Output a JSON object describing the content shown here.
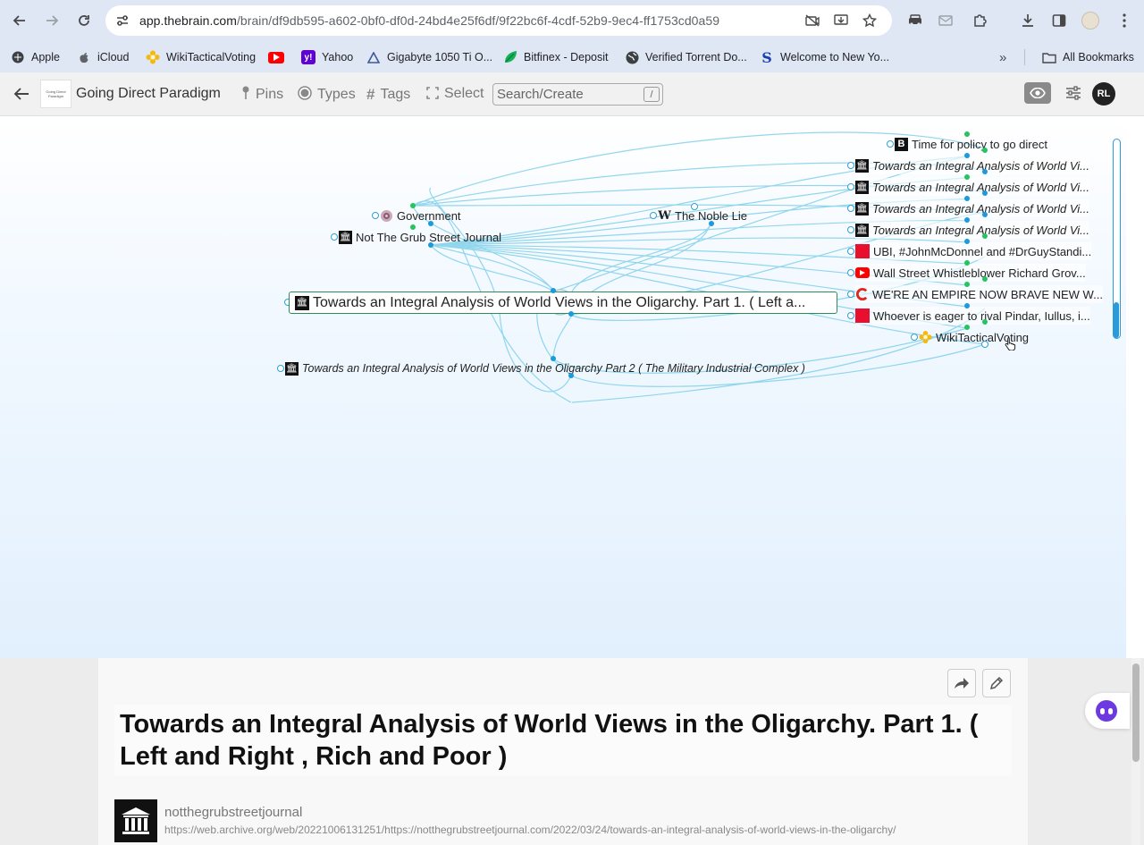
{
  "browser": {
    "url_host": "app.thebrain.com",
    "url_path": "/brain/df9db595-a602-0bf0-df0d-24bd4e25f6df/9f22bc6f-4cdf-52b9-9ec4-ff1753cd0a59",
    "bookmarks": [
      {
        "label": "Apple",
        "icon": "apple-icon"
      },
      {
        "label": "iCloud",
        "icon": "apple-icon"
      },
      {
        "label": "WikiTacticalVoting",
        "icon": "flower-icon"
      },
      {
        "label": "",
        "icon": "youtube-icon"
      },
      {
        "label": "Yahoo",
        "icon": "yahoo-icon"
      },
      {
        "label": "Gigabyte 1050 Ti O...",
        "icon": "triangle-icon"
      },
      {
        "label": "Bitfinex - Deposit",
        "icon": "leaf-icon"
      },
      {
        "label": "Verified Torrent Do...",
        "icon": "globe-icon"
      },
      {
        "label": "Welcome to New Yo...",
        "icon": "s-icon"
      }
    ],
    "overflow_label": "»",
    "all_bookmarks_label": "All Bookmarks"
  },
  "header": {
    "brain_thumb_text": "Going Direct Paradigm",
    "brain_title": "Going Direct Paradigm",
    "pins_label": "Pins",
    "types_label": "Types",
    "tags_label": "Tags",
    "select_label": "Select",
    "search_placeholder": "Search/Create",
    "search_shortcut": "/",
    "avatar_initials": "RL"
  },
  "plex": {
    "active_thought": "Towards an Integral Analysis of World Views in the Oligarchy. Part 1. ( Left a...",
    "parents": [
      {
        "label": "Government",
        "icon": "government-icon"
      },
      {
        "label": "Not The Grub Street Journal",
        "icon": "bank-icon"
      }
    ],
    "child": {
      "label": "Towards an Integral Analysis of World Views in the Oligarchy Part 2 ( The Military Industrial Complex )",
      "icon": "bank-icon"
    },
    "jump": {
      "label": "The Noble Lie",
      "icon": "wikipedia-icon"
    },
    "siblings": [
      {
        "label": "Time for policy to go direct",
        "icon": "bloomberg-icon",
        "italic": false
      },
      {
        "label": "Towards an Integral Analysis of World Vi...",
        "icon": "bank-icon",
        "italic": true
      },
      {
        "label": "Towards an Integral Analysis of World Vi...",
        "icon": "bank-icon",
        "italic": true
      },
      {
        "label": "Towards an Integral Analysis of World Vi...",
        "icon": "bank-icon",
        "italic": true
      },
      {
        "label": "Towards an Integral Analysis of World Vi...",
        "icon": "bank-icon",
        "italic": true
      },
      {
        "label": "UBI, #JohnMcDonnel and #DrGuyStandi...",
        "icon": "red-square-icon",
        "italic": false
      },
      {
        "label": "Wall Street Whistleblower Richard Grov...",
        "icon": "youtube-icon",
        "italic": false
      },
      {
        "label": "WE'RE AN EMPIRE NOW BRAVE NEW W...",
        "icon": "red-c-icon",
        "italic": false
      },
      {
        "label": "Whoever is eager to rival Pindar, Iullus, i...",
        "icon": "red-square-icon",
        "italic": false
      },
      {
        "label": "WikiTacticalVoting",
        "icon": "flower-icon",
        "italic": false
      }
    ]
  },
  "notes": {
    "title": "Towards an Integral Analysis of World Views in the Oligarchy. Part 1. ( Left and Right , Rich and Poor )",
    "link_name": "notthegrubstreetjournal",
    "link_url": "https://web.archive.org/web/20221006131251/https://notthegrubstreetjournal.com/2022/03/24/towards-an-integral-analysis-of-world-views-in-the-oligarchy/"
  },
  "colors": {
    "link_line": "#7fd0ea",
    "active_border": "#2e8b57",
    "green_dot": "#22c55e",
    "blue_dot": "#1a9bdc"
  }
}
